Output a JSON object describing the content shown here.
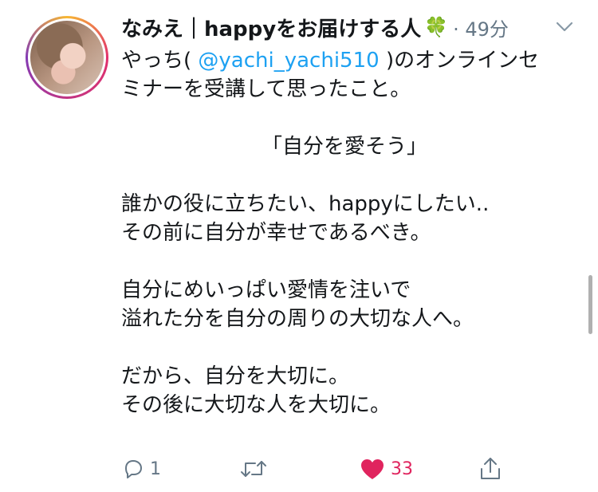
{
  "tweet": {
    "author_name": "なみえ｜happyをお届けする人",
    "author_emoji": "🍀",
    "time": "· 49分",
    "body": {
      "line1_prefix": "やっち( ",
      "mention": "@yachi_yachi510",
      "line1_suffix": " )のオンラインセ",
      "line2": "ミナーを受講して思ったこと。",
      "quote": "「自分を愛そう」",
      "line3": "誰かの役に立ちたい、happyにしたい..",
      "line4": "その前に自分が幸せであるべき。",
      "line5": "自分にめいっぱい愛情を注いで",
      "line6": "溢れた分を自分の周りの大切な人へ。",
      "line7": "だから、自分を大切に。",
      "line8": "その後に大切な人を大切に。"
    },
    "actions": {
      "reply_count": "1",
      "retweet_count": "",
      "like_count": "33"
    }
  },
  "colors": {
    "mention": "#1da1f2",
    "like": "#e0245e",
    "muted": "#657786"
  },
  "icons": {
    "reply": "reply-icon",
    "retweet": "retweet-icon",
    "like": "heart-icon",
    "share": "share-icon",
    "menu": "chevron-down-icon"
  }
}
